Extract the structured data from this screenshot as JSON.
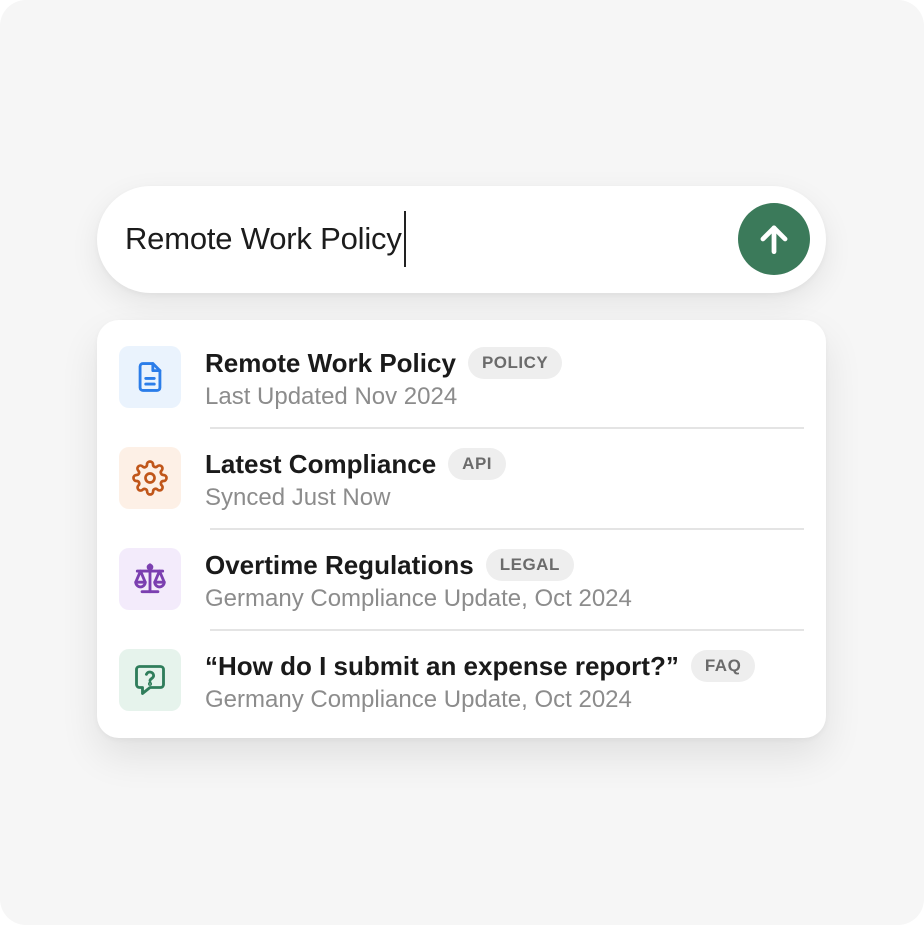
{
  "search": {
    "value": "Remote Work Policy",
    "submit_icon": "arrow-up-icon",
    "accent_color": "#3b7a5a"
  },
  "results": [
    {
      "title": "Remote Work Policy",
      "badge": "POLICY",
      "subtitle": "Last Updated Nov 2024",
      "icon": "document-icon",
      "icon_color": "#2b7de9",
      "icon_bg": "#eaf3fd"
    },
    {
      "title": "Latest Compliance",
      "badge": "API",
      "subtitle": "Synced Just Now",
      "icon": "gear-icon",
      "icon_color": "#c0561a",
      "icon_bg": "#fdf0e6"
    },
    {
      "title": "Overtime Regulations",
      "badge": "LEGAL",
      "subtitle": "Germany Compliance Update, Oct 2024",
      "icon": "scales-icon",
      "icon_color": "#7b3fb0",
      "icon_bg": "#f3ebfb"
    },
    {
      "title": "“How do I submit an expense report?”",
      "badge": "FAQ",
      "subtitle": "Germany Compliance Update, Oct 2024",
      "icon": "question-chat-icon",
      "icon_color": "#2f7d5b",
      "icon_bg": "#e6f3ec"
    }
  ]
}
